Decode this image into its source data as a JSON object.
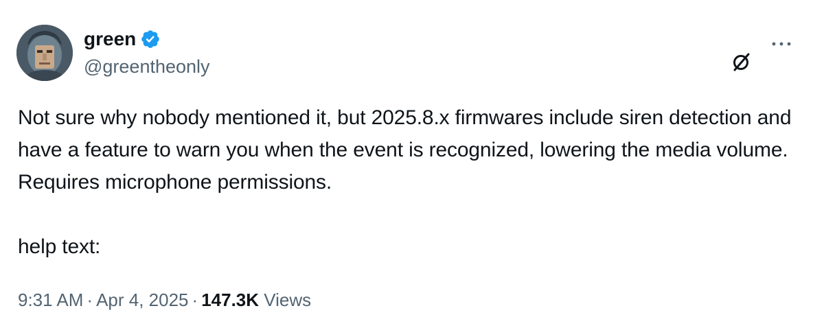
{
  "author": {
    "display_name": "green",
    "handle": "@greentheonly",
    "verified": true,
    "verified_color": "#1d9bf0"
  },
  "actions": {
    "grok_icon": "slashed-circle-icon",
    "more_icon": "ellipsis-icon"
  },
  "tweet": {
    "text": "Not sure why nobody mentioned it, but 2025.8.x firmwares include siren detection and have a feature to warn you when the event is recognized, lowering the media volume. Requires microphone permissions.\n\nhelp text:"
  },
  "meta": {
    "time": "9:31 AM",
    "date": "Apr 4, 2025",
    "separator": "·",
    "views_count": "147.3K",
    "views_label": "Views"
  },
  "colors": {
    "text_primary": "#0f1419",
    "text_secondary": "#536471",
    "background": "#ffffff"
  }
}
